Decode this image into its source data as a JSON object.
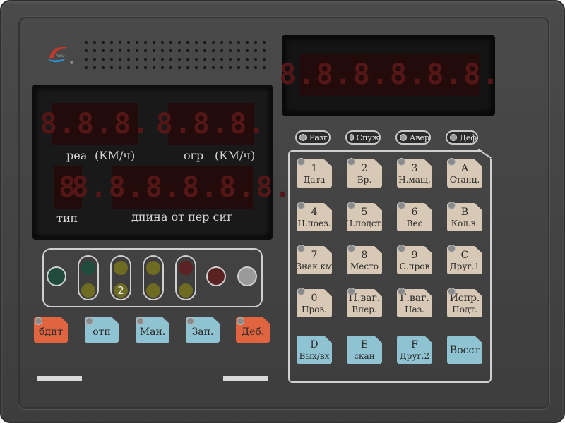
{
  "logo": {
    "text": "IGG"
  },
  "main_display": {
    "real_digits": "8.8.8.",
    "limit_digits": "8.8.8.",
    "type_digit": "8",
    "length_digits": "8.8.8.8.8.8.",
    "label_real": "реа",
    "label_real_unit": "(КМ/ч)",
    "label_limit": "огр",
    "label_limit_unit": "(КМ/ч)",
    "label_type": "тип",
    "label_length": "дпина от пер сиг"
  },
  "top_display": {
    "digits": "8.8.8.8.8.8."
  },
  "status": [
    {
      "label": "Разг"
    },
    {
      "label": "Спуж"
    },
    {
      "label": "Авер"
    },
    {
      "label": "Деф"
    }
  ],
  "signal": {
    "number": "2",
    "colors": {
      "green": "#1f4a3c",
      "yellow": "#6e6b22",
      "red": "#5a2222",
      "white": "#9a9a9a"
    }
  },
  "function_buttons": [
    {
      "label": "бдит",
      "color": "#e0643f"
    },
    {
      "label": "отп",
      "color": "#8fc3d1"
    },
    {
      "label": "Ман.",
      "color": "#8fc3d1"
    },
    {
      "label": "Зап.",
      "color": "#8fc3d1"
    },
    {
      "label": "Деб.",
      "color": "#e0643f"
    }
  ],
  "keypad": [
    {
      "top": "1",
      "bottom": "Дата"
    },
    {
      "top": "2",
      "bottom": "Вр."
    },
    {
      "top": "3",
      "bottom": "Н.мащ."
    },
    {
      "top": "A",
      "bottom": "Станц."
    },
    {
      "top": "4",
      "bottom": "Н.поез."
    },
    {
      "top": "5",
      "bottom": "Н.подст."
    },
    {
      "top": "6",
      "bottom": "Вес"
    },
    {
      "top": "B",
      "bottom": "Кол.в."
    },
    {
      "top": "7",
      "bottom": "Знак.км"
    },
    {
      "top": "8",
      "bottom": "Место"
    },
    {
      "top": "9",
      "bottom": "С.пров"
    },
    {
      "top": "C",
      "bottom": "Друг.1"
    },
    {
      "top": "0",
      "bottom": "Пров."
    },
    {
      "top": "П.ваг.",
      "bottom": "Впер."
    },
    {
      "top": "Г.ваг.",
      "bottom": "Наз."
    },
    {
      "top": "Испр.",
      "bottom": "Подт."
    },
    {
      "top": "D",
      "bottom": "Вых/вх"
    },
    {
      "top": "E",
      "bottom": "скан"
    },
    {
      "top": "F",
      "bottom": "Друг.2"
    },
    {
      "top": "Восст",
      "bottom": ""
    }
  ],
  "colors": {
    "panel_bg": "#3f3f3f",
    "key_beige": "#d8c8b6",
    "key_blue": "#8fc3d1",
    "key_orange": "#e0643f",
    "segment_off": "#541616"
  }
}
